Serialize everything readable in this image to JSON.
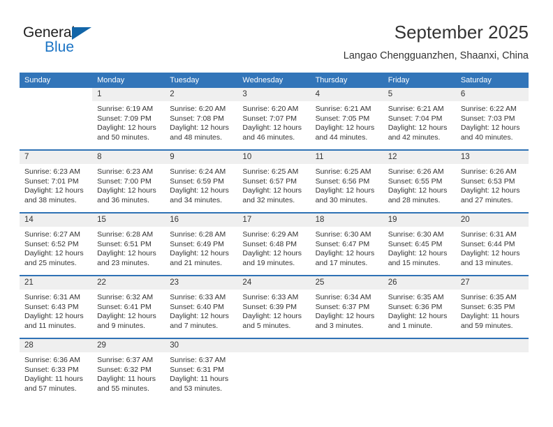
{
  "brand": {
    "name_part1": "General",
    "name_part2": "Blue",
    "triangle_color": "#1265a8",
    "blue_color": "#1a73c4"
  },
  "header": {
    "title": "September 2025",
    "subtitle": "Langao Chengguanzhen, Shaanxi, China"
  },
  "theme": {
    "header_bg": "#3275b9",
    "row_divider": "#2f72b5",
    "daynum_band": "#efefef"
  },
  "calendar": {
    "weekdays": [
      "Sunday",
      "Monday",
      "Tuesday",
      "Wednesday",
      "Thursday",
      "Friday",
      "Saturday"
    ],
    "weeks": [
      [
        {
          "day": "",
          "blank": true,
          "sunrise": "",
          "sunset": "",
          "daylight1": "",
          "daylight2": ""
        },
        {
          "day": "1",
          "sunrise": "Sunrise: 6:19 AM",
          "sunset": "Sunset: 7:09 PM",
          "daylight1": "Daylight: 12 hours",
          "daylight2": "and 50 minutes."
        },
        {
          "day": "2",
          "sunrise": "Sunrise: 6:20 AM",
          "sunset": "Sunset: 7:08 PM",
          "daylight1": "Daylight: 12 hours",
          "daylight2": "and 48 minutes."
        },
        {
          "day": "3",
          "sunrise": "Sunrise: 6:20 AM",
          "sunset": "Sunset: 7:07 PM",
          "daylight1": "Daylight: 12 hours",
          "daylight2": "and 46 minutes."
        },
        {
          "day": "4",
          "sunrise": "Sunrise: 6:21 AM",
          "sunset": "Sunset: 7:05 PM",
          "daylight1": "Daylight: 12 hours",
          "daylight2": "and 44 minutes."
        },
        {
          "day": "5",
          "sunrise": "Sunrise: 6:21 AM",
          "sunset": "Sunset: 7:04 PM",
          "daylight1": "Daylight: 12 hours",
          "daylight2": "and 42 minutes."
        },
        {
          "day": "6",
          "sunrise": "Sunrise: 6:22 AM",
          "sunset": "Sunset: 7:03 PM",
          "daylight1": "Daylight: 12 hours",
          "daylight2": "and 40 minutes."
        }
      ],
      [
        {
          "day": "7",
          "sunrise": "Sunrise: 6:23 AM",
          "sunset": "Sunset: 7:01 PM",
          "daylight1": "Daylight: 12 hours",
          "daylight2": "and 38 minutes."
        },
        {
          "day": "8",
          "sunrise": "Sunrise: 6:23 AM",
          "sunset": "Sunset: 7:00 PM",
          "daylight1": "Daylight: 12 hours",
          "daylight2": "and 36 minutes."
        },
        {
          "day": "9",
          "sunrise": "Sunrise: 6:24 AM",
          "sunset": "Sunset: 6:59 PM",
          "daylight1": "Daylight: 12 hours",
          "daylight2": "and 34 minutes."
        },
        {
          "day": "10",
          "sunrise": "Sunrise: 6:25 AM",
          "sunset": "Sunset: 6:57 PM",
          "daylight1": "Daylight: 12 hours",
          "daylight2": "and 32 minutes."
        },
        {
          "day": "11",
          "sunrise": "Sunrise: 6:25 AM",
          "sunset": "Sunset: 6:56 PM",
          "daylight1": "Daylight: 12 hours",
          "daylight2": "and 30 minutes."
        },
        {
          "day": "12",
          "sunrise": "Sunrise: 6:26 AM",
          "sunset": "Sunset: 6:55 PM",
          "daylight1": "Daylight: 12 hours",
          "daylight2": "and 28 minutes."
        },
        {
          "day": "13",
          "sunrise": "Sunrise: 6:26 AM",
          "sunset": "Sunset: 6:53 PM",
          "daylight1": "Daylight: 12 hours",
          "daylight2": "and 27 minutes."
        }
      ],
      [
        {
          "day": "14",
          "sunrise": "Sunrise: 6:27 AM",
          "sunset": "Sunset: 6:52 PM",
          "daylight1": "Daylight: 12 hours",
          "daylight2": "and 25 minutes."
        },
        {
          "day": "15",
          "sunrise": "Sunrise: 6:28 AM",
          "sunset": "Sunset: 6:51 PM",
          "daylight1": "Daylight: 12 hours",
          "daylight2": "and 23 minutes."
        },
        {
          "day": "16",
          "sunrise": "Sunrise: 6:28 AM",
          "sunset": "Sunset: 6:49 PM",
          "daylight1": "Daylight: 12 hours",
          "daylight2": "and 21 minutes."
        },
        {
          "day": "17",
          "sunrise": "Sunrise: 6:29 AM",
          "sunset": "Sunset: 6:48 PM",
          "daylight1": "Daylight: 12 hours",
          "daylight2": "and 19 minutes."
        },
        {
          "day": "18",
          "sunrise": "Sunrise: 6:30 AM",
          "sunset": "Sunset: 6:47 PM",
          "daylight1": "Daylight: 12 hours",
          "daylight2": "and 17 minutes."
        },
        {
          "day": "19",
          "sunrise": "Sunrise: 6:30 AM",
          "sunset": "Sunset: 6:45 PM",
          "daylight1": "Daylight: 12 hours",
          "daylight2": "and 15 minutes."
        },
        {
          "day": "20",
          "sunrise": "Sunrise: 6:31 AM",
          "sunset": "Sunset: 6:44 PM",
          "daylight1": "Daylight: 12 hours",
          "daylight2": "and 13 minutes."
        }
      ],
      [
        {
          "day": "21",
          "sunrise": "Sunrise: 6:31 AM",
          "sunset": "Sunset: 6:43 PM",
          "daylight1": "Daylight: 12 hours",
          "daylight2": "and 11 minutes."
        },
        {
          "day": "22",
          "sunrise": "Sunrise: 6:32 AM",
          "sunset": "Sunset: 6:41 PM",
          "daylight1": "Daylight: 12 hours",
          "daylight2": "and 9 minutes."
        },
        {
          "day": "23",
          "sunrise": "Sunrise: 6:33 AM",
          "sunset": "Sunset: 6:40 PM",
          "daylight1": "Daylight: 12 hours",
          "daylight2": "and 7 minutes."
        },
        {
          "day": "24",
          "sunrise": "Sunrise: 6:33 AM",
          "sunset": "Sunset: 6:39 PM",
          "daylight1": "Daylight: 12 hours",
          "daylight2": "and 5 minutes."
        },
        {
          "day": "25",
          "sunrise": "Sunrise: 6:34 AM",
          "sunset": "Sunset: 6:37 PM",
          "daylight1": "Daylight: 12 hours",
          "daylight2": "and 3 minutes."
        },
        {
          "day": "26",
          "sunrise": "Sunrise: 6:35 AM",
          "sunset": "Sunset: 6:36 PM",
          "daylight1": "Daylight: 12 hours",
          "daylight2": "and 1 minute."
        },
        {
          "day": "27",
          "sunrise": "Sunrise: 6:35 AM",
          "sunset": "Sunset: 6:35 PM",
          "daylight1": "Daylight: 11 hours",
          "daylight2": "and 59 minutes."
        }
      ],
      [
        {
          "day": "28",
          "sunrise": "Sunrise: 6:36 AM",
          "sunset": "Sunset: 6:33 PM",
          "daylight1": "Daylight: 11 hours",
          "daylight2": "and 57 minutes."
        },
        {
          "day": "29",
          "sunrise": "Sunrise: 6:37 AM",
          "sunset": "Sunset: 6:32 PM",
          "daylight1": "Daylight: 11 hours",
          "daylight2": "and 55 minutes."
        },
        {
          "day": "30",
          "sunrise": "Sunrise: 6:37 AM",
          "sunset": "Sunset: 6:31 PM",
          "daylight1": "Daylight: 11 hours",
          "daylight2": "and 53 minutes."
        },
        {
          "day": "",
          "empty": true,
          "sunrise": "",
          "sunset": "",
          "daylight1": "",
          "daylight2": ""
        },
        {
          "day": "",
          "empty": true,
          "sunrise": "",
          "sunset": "",
          "daylight1": "",
          "daylight2": ""
        },
        {
          "day": "",
          "empty": true,
          "sunrise": "",
          "sunset": "",
          "daylight1": "",
          "daylight2": ""
        },
        {
          "day": "",
          "empty": true,
          "sunrise": "",
          "sunset": "",
          "daylight1": "",
          "daylight2": ""
        }
      ]
    ]
  }
}
